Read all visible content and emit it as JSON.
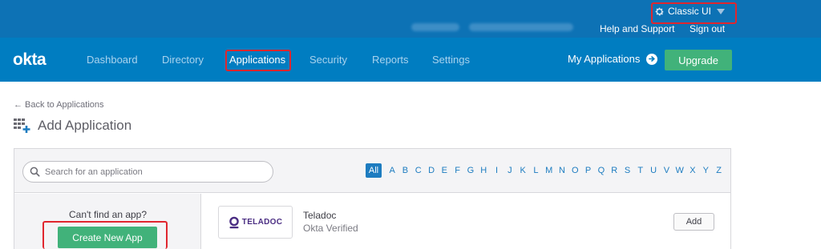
{
  "topbar": {
    "classic_ui": "Classic UI",
    "help_label": "Help and Support",
    "signout_label": "Sign out"
  },
  "nav": {
    "logo": "okta",
    "items": [
      {
        "label": "Dashboard"
      },
      {
        "label": "Directory"
      },
      {
        "label": "Applications"
      },
      {
        "label": "Security"
      },
      {
        "label": "Reports"
      },
      {
        "label": "Settings"
      }
    ],
    "my_apps": "My Applications",
    "upgrade": "Upgrade"
  },
  "page": {
    "back": "← Back to Applications",
    "title": "Add Application"
  },
  "search": {
    "placeholder": "Search for an application"
  },
  "filter": {
    "all": "All",
    "letters": [
      "A",
      "B",
      "C",
      "D",
      "E",
      "F",
      "G",
      "H",
      "I",
      "J",
      "K",
      "L",
      "M",
      "N",
      "O",
      "P",
      "Q",
      "R",
      "S",
      "T",
      "U",
      "V",
      "W",
      "X",
      "Y",
      "Z"
    ]
  },
  "sidebar": {
    "cant_find": "Can't find an app?",
    "create_button": "Create New App"
  },
  "apps": [
    {
      "logo_text": "TELADOC",
      "name": "Teladoc",
      "status": "Okta Verified",
      "add_label": "Add"
    }
  ],
  "colors": {
    "topbar": "#0d72b5",
    "navbar": "#007dc1",
    "accent_green": "#41b27a",
    "highlight_red": "#e0262e",
    "link_blue": "#1d7cc0",
    "teladoc_purple": "#4b2e83"
  }
}
